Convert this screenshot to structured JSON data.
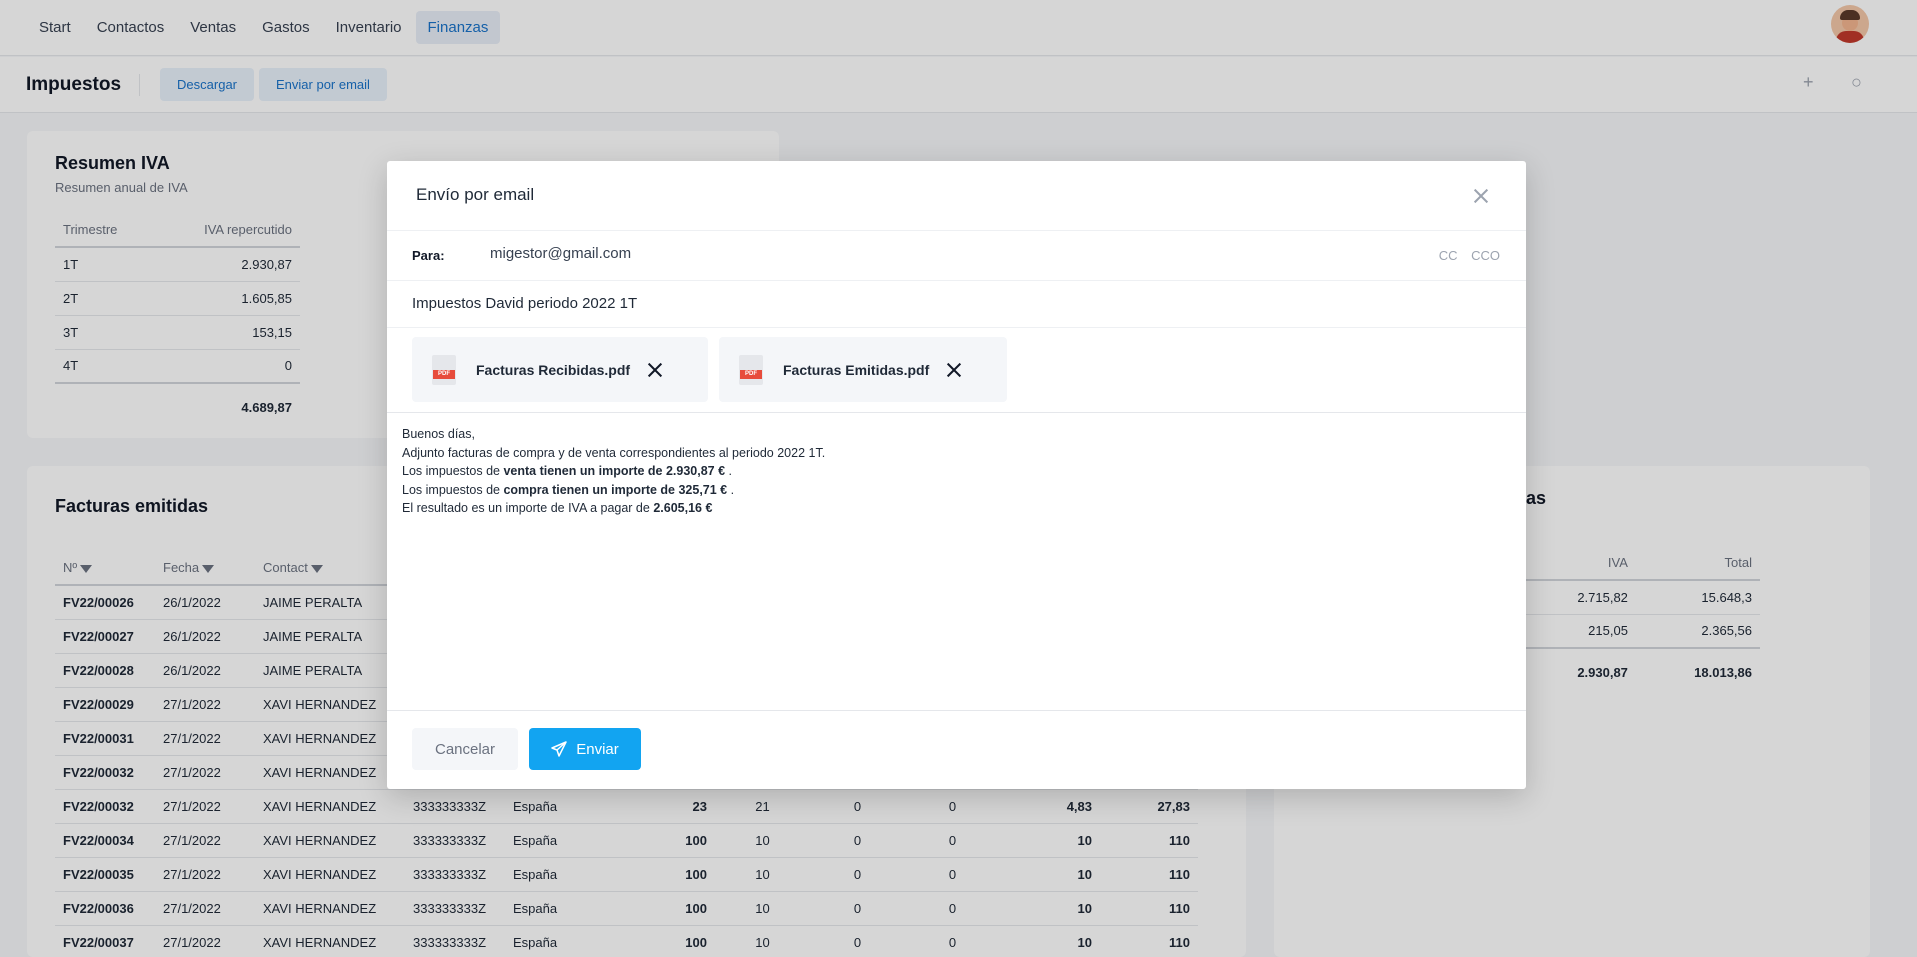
{
  "nav": {
    "items": [
      "Start",
      "Contactos",
      "Ventas",
      "Gastos",
      "Inventario",
      "Finanzas"
    ],
    "active": "Finanzas"
  },
  "subheader": {
    "title": "Impuestos",
    "download_label": "Descargar",
    "email_label": "Enviar por email",
    "add_icon": "+",
    "search_icon": "○"
  },
  "iva_summary": {
    "title": "Resumen IVA",
    "subtitle": "Resumen anual de IVA",
    "columns": [
      "Trimestre",
      "IVA repercutido"
    ],
    "rows": [
      {
        "q": "1T",
        "v": "2.930,87"
      },
      {
        "q": "2T",
        "v": "1.605,85"
      },
      {
        "q": "3T",
        "v": "153,15"
      },
      {
        "q": "4T",
        "v": "0"
      }
    ],
    "total": "4.689,87"
  },
  "invoices": {
    "title": "Facturas emitidas",
    "columns": [
      "Nº",
      "Fecha",
      "Contact"
    ],
    "rows": [
      {
        "n": "FV22/00026",
        "d": "26/1/2022",
        "c": "JAIME PERALTA"
      },
      {
        "n": "FV22/00027",
        "d": "26/1/2022",
        "c": "JAIME PERALTA"
      },
      {
        "n": "FV22/00028",
        "d": "26/1/2022",
        "c": "JAIME PERALTA"
      },
      {
        "n": "FV22/00029",
        "d": "27/1/2022",
        "c": "XAVI HERNANDEZ"
      },
      {
        "n": "FV22/00031",
        "d": "27/1/2022",
        "c": "XAVI HERNANDEZ"
      },
      {
        "n": "FV22/00032",
        "d": "27/1/2022",
        "c": "XAVI HERNANDEZ"
      },
      {
        "n": "FV22/00032",
        "d": "27/1/2022",
        "c": "XAVI HERNANDEZ",
        "nif": "333333333Z",
        "pais": "España",
        "base": "23",
        "pct": "21",
        "z1": "0",
        "z2": "0",
        "iva": "4,83",
        "total": "27,83"
      },
      {
        "n": "FV22/00034",
        "d": "27/1/2022",
        "c": "XAVI HERNANDEZ",
        "nif": "333333333Z",
        "pais": "España",
        "base": "100",
        "pct": "10",
        "z1": "0",
        "z2": "0",
        "iva": "10",
        "total": "110"
      },
      {
        "n": "FV22/00035",
        "d": "27/1/2022",
        "c": "XAVI HERNANDEZ",
        "nif": "333333333Z",
        "pais": "España",
        "base": "100",
        "pct": "10",
        "z1": "0",
        "z2": "0",
        "iva": "10",
        "total": "110"
      },
      {
        "n": "FV22/00036",
        "d": "27/1/2022",
        "c": "XAVI HERNANDEZ",
        "nif": "333333333Z",
        "pais": "España",
        "base": "100",
        "pct": "10",
        "z1": "0",
        "z2": "0",
        "iva": "10",
        "total": "110"
      },
      {
        "n": "FV22/00037",
        "d": "27/1/2022",
        "c": "XAVI HERNANDEZ",
        "nif": "333333333Z",
        "pais": "España",
        "base": "100",
        "pct": "10",
        "z1": "0",
        "z2": "0",
        "iva": "10",
        "total": "110"
      }
    ]
  },
  "received": {
    "title_fragment": "as",
    "columns": [
      "IVA",
      "Total"
    ],
    "rows": [
      {
        "iva": "2.715,82",
        "total": "15.648,3"
      },
      {
        "iva": "215,05",
        "total": "2.365,56"
      }
    ],
    "total_iva": "2.930,87",
    "total": "18.013,86"
  },
  "modal": {
    "title": "Envío por email",
    "to_label": "Para:",
    "to_value": "migestor@gmail.com",
    "cc_label": "CC",
    "cco_label": "CCO",
    "subject": "Impuestos David periodo 2022 1T",
    "attachments": [
      {
        "name": "Facturas Recibidas.pdf"
      },
      {
        "name": "Facturas Emitidas.pdf"
      }
    ],
    "body": {
      "line1": "Buenos días,",
      "line2": "Adjunto facturas de compra y de venta correspondientes al periodo 2022 1T.",
      "line3_pre": "Los impuestos de ",
      "line3_bold": "venta tienen un importe de 2.930,87 €",
      "line3_post": " .",
      "line4_pre": "Los impuestos de ",
      "line4_bold": "compra tienen un importe de 325,71 €",
      "line4_post": " .",
      "line5_pre": "El resultado es un importe de IVA a pagar de ",
      "line5_bold": "2.605,16 €"
    },
    "cancel_label": "Cancelar",
    "send_label": "Enviar"
  }
}
